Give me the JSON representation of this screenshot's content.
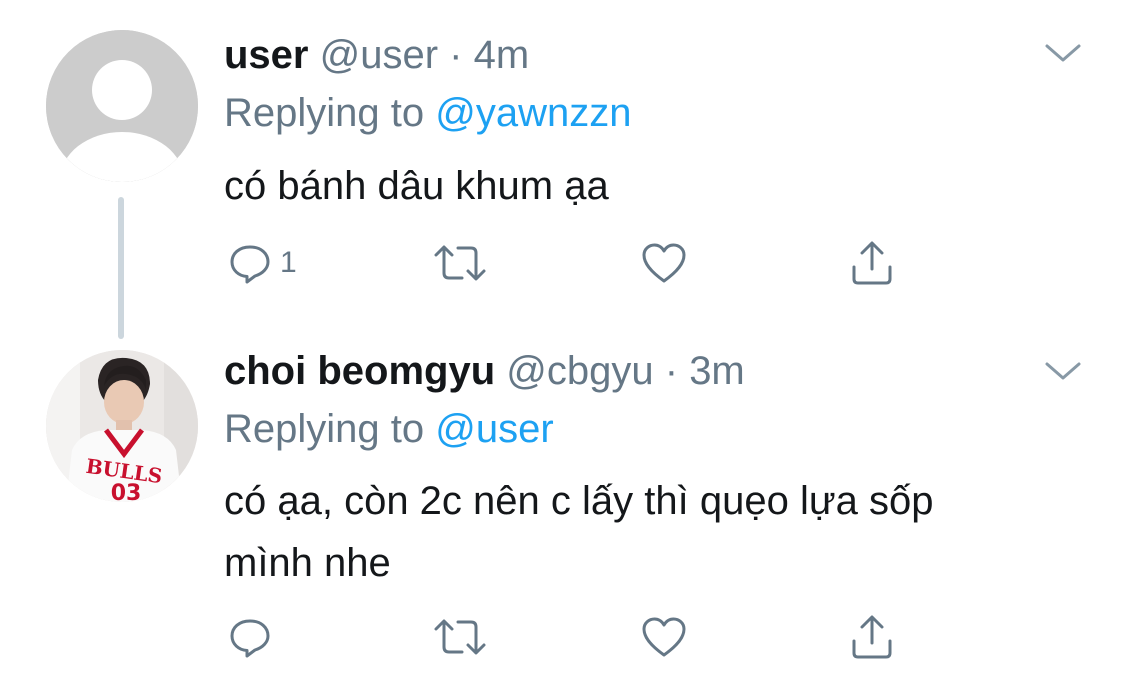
{
  "thread": [
    {
      "display_name": "user",
      "handle": "@user",
      "separator": "·",
      "time": "4m",
      "replying_prefix": "Replying to",
      "replying_to": "@yawnzzn",
      "text": "có bánh dâu khum ạa",
      "reply_count": "1",
      "avatar": "default-avatar-icon"
    },
    {
      "display_name": "choi beomgyu",
      "handle": "@cbgyu",
      "separator": "·",
      "time": "3m",
      "replying_prefix": "Replying to",
      "replying_to": "@user",
      "text_line1": "có ạa, còn 2c nên c lấy thì quẹo lựa sốp",
      "text_line2": "mình nhe",
      "reply_count": "",
      "avatar": "profile-photo"
    }
  ],
  "colors": {
    "text": "#14171a",
    "secondary": "#657786",
    "link": "#1da1f2",
    "thread_line": "#ccd6dd",
    "icon": "#657786"
  }
}
